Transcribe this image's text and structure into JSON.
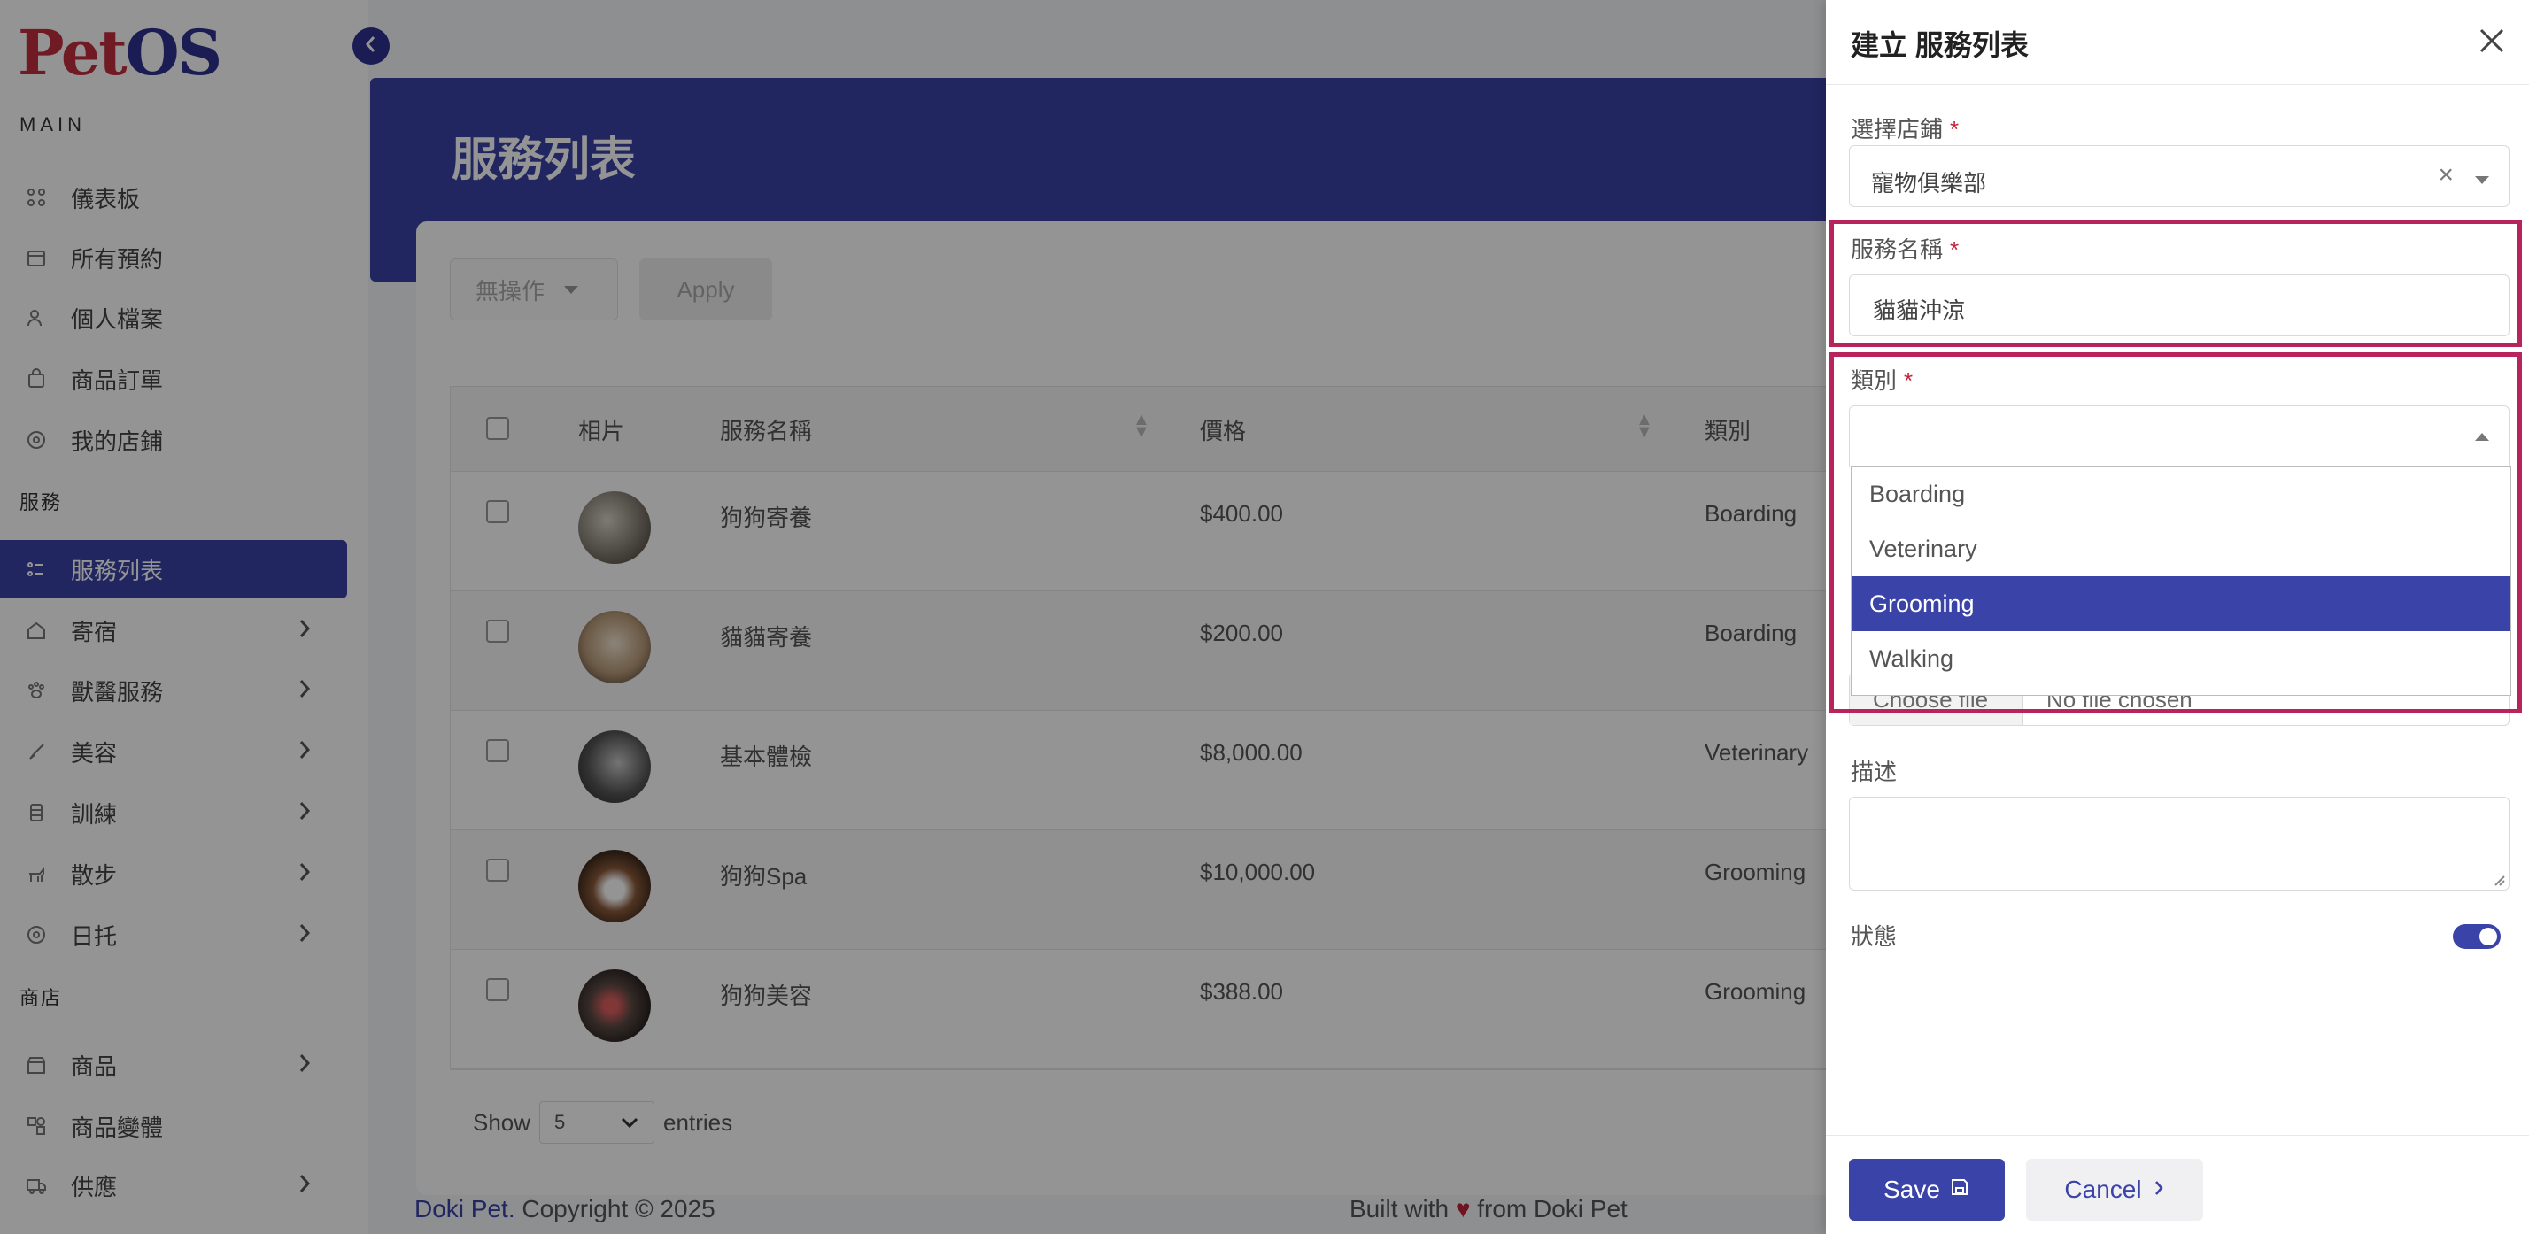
{
  "brand": {
    "logo_pet": "Pet",
    "logo_os": "OS"
  },
  "sidebar": {
    "section_main": "MAIN",
    "section_services": "服務",
    "section_shop": "商店",
    "items": [
      {
        "label": "儀表板",
        "icon": "dashboard-icon"
      },
      {
        "label": "所有預約",
        "icon": "calendar-icon"
      },
      {
        "label": "個人檔案",
        "icon": "user-icon"
      },
      {
        "label": "商品訂單",
        "icon": "bag-icon"
      },
      {
        "label": "我的店鋪",
        "icon": "store-icon"
      },
      {
        "label": "服務列表",
        "icon": "list-icon"
      },
      {
        "label": "寄宿",
        "icon": "home-icon"
      },
      {
        "label": "獸醫服務",
        "icon": "vet-icon"
      },
      {
        "label": "美容",
        "icon": "brush-icon"
      },
      {
        "label": "訓練",
        "icon": "training-icon"
      },
      {
        "label": "散步",
        "icon": "dog-icon"
      },
      {
        "label": "日托",
        "icon": "daycare-icon"
      },
      {
        "label": "商品",
        "icon": "shop-icon"
      },
      {
        "label": "商品變體",
        "icon": "variant-icon"
      },
      {
        "label": "供應",
        "icon": "truck-icon"
      }
    ]
  },
  "page": {
    "title": "服務列表",
    "bulk_action": "無操作",
    "apply_label": "Apply",
    "table": {
      "headers": [
        "相片",
        "服務名稱",
        "價格",
        "類別"
      ],
      "rows": [
        {
          "name": "狗狗寄養",
          "price": "$400.00",
          "category": "Boarding"
        },
        {
          "name": "貓貓寄養",
          "price": "$200.00",
          "category": "Boarding"
        },
        {
          "name": "基本體檢",
          "price": "$8,000.00",
          "category": "Veterinary"
        },
        {
          "name": "狗狗Spa",
          "price": "$10,000.00",
          "category": "Grooming"
        },
        {
          "name": "狗狗美容",
          "price": "$388.00",
          "category": "Grooming"
        }
      ]
    },
    "show_label": "Show",
    "entries_value": "5",
    "entries_label": "entries"
  },
  "footer": {
    "brand": "Doki Pet.",
    "copyright": " Copyright © 2025",
    "built_with": "Built with",
    "heart": "♥",
    "from": " from Doki Pet"
  },
  "drawer": {
    "title": "建立 服務列表",
    "store_label": "選擇店鋪",
    "store_value": "寵物俱樂部",
    "service_name_label": "服務名稱",
    "service_name_value": "貓貓沖涼",
    "category_label": "類別",
    "category_options": [
      "Boarding",
      "Veterinary",
      "Grooming",
      "Walking"
    ],
    "category_highlighted": "Grooming",
    "file_button": "Choose file",
    "file_status": "No file chosen",
    "description_label": "描述",
    "status_label": "狀態",
    "status_on": true,
    "save_label": "Save",
    "cancel_label": "Cancel",
    "required_mark": "*",
    "accent": "#3a43a8",
    "highlight_color": "#b8245c"
  }
}
